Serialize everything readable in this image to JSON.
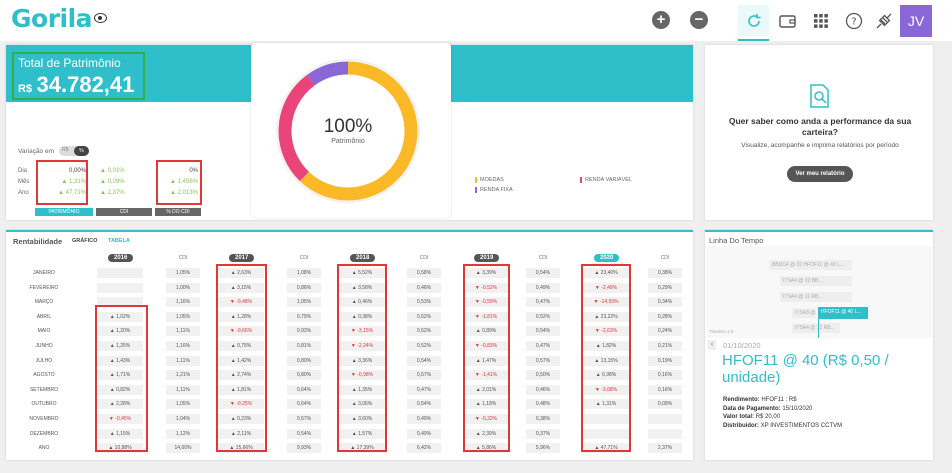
{
  "app": {
    "logo": "Gorila",
    "user_initials": "JV"
  },
  "icons": [
    "eye-icon",
    "plus-icon",
    "minus-icon",
    "refresh-icon",
    "wallet-icon",
    "grid-icon",
    "help-icon",
    "plug-icon"
  ],
  "patrimonio": {
    "title": "Total de Patrimônio",
    "currency": "R$",
    "value": "34.782,41",
    "variacao_label": "Variação em",
    "toggle_a": "R$",
    "toggle_b": "%",
    "row_labels": [
      "Dia",
      "Mês",
      "Ano"
    ],
    "col1": [
      "0,00%",
      "▲ 1,31%",
      "▲ 47,71%"
    ],
    "col2": [
      "▲ 0,01%",
      "▲ 0,09%",
      "▲ 2,37%"
    ],
    "col3": [
      "0%",
      "▲ 1,456%",
      "▲ 2,013%"
    ],
    "col_labels": [
      "PATRIMÔNIO",
      "CDI",
      "% DO CDI"
    ]
  },
  "donut": {
    "pct": "100%",
    "label": "Patrimônio"
  },
  "legend": [
    "MOEDAS",
    "RENDA VARIÁVEL",
    "RENDA FIXA"
  ],
  "colors": {
    "accent": "#2fbfca",
    "moedas": "#fbb827",
    "renda_variavel": "#e9457a",
    "renda_fixa": "#8a67d6"
  },
  "promo": {
    "title": "Quer saber como anda a performance da sua carteira?",
    "text": "Visualize, acompanhe e imprima relatórios por período",
    "button": "Ver meu relatório"
  },
  "rent": {
    "title": "Rentabilidade",
    "tab1": "GRÁFICO",
    "tab2": "TABELA",
    "years": [
      "2016",
      "2017",
      "2018",
      "2019",
      "2020"
    ],
    "cdi": "CDI",
    "months": [
      "JANEIRO",
      "FEVEREIRO",
      "MARÇO",
      "ABRIL",
      "MAIO",
      "JUNHO",
      "JULHO",
      "AGOSTO",
      "SETEMBRO",
      "OUTUBRO",
      "NOVEMBRO",
      "DEZEMBRO",
      "ANO"
    ],
    "c2016": [
      "",
      "",
      "",
      "▲ 1,02%",
      "▲ 1,20%",
      "▲ 1,25%",
      "▲ 1,43%",
      "▲ 1,71%",
      "▲ 0,82%",
      "▲ 2,28%",
      "▼ -0,45%",
      "▲ 1,15%",
      "▲ 10,88%"
    ],
    "cdi2016": [
      "1,05%",
      "1,00%",
      "1,16%",
      "1,05%",
      "1,11%",
      "1,16%",
      "1,11%",
      "1,21%",
      "1,11%",
      "1,05%",
      "1,04%",
      "1,12%",
      "14,00%"
    ],
    "c2017": [
      "▲ 2,63%",
      "▲ 3,15%",
      "▼ -0,48%",
      "▲ 1,28%",
      "▼ -0,66%",
      "▲ 0,75%",
      "▲ 1,42%",
      "▲ 2,74%",
      "▲ 1,81%",
      "▼ -0,25%",
      "▲ 0,23%",
      "▲ 2,11%",
      "▲ 15,66%"
    ],
    "cdi2017": [
      "1,08%",
      "0,86%",
      "1,05%",
      "0,79%",
      "0,93%",
      "0,81%",
      "0,80%",
      "0,80%",
      "0,64%",
      "0,64%",
      "0,57%",
      "0,54%",
      "9,93%"
    ],
    "c2018": [
      "▲ 5,52%",
      "▲ 3,58%",
      "▲ 0,46%",
      "▲ 0,38%",
      "▼ -3,15%",
      "▼ -2,24%",
      "▲ 3,36%",
      "▼ -0,98%",
      "▲ 1,35%",
      "▲ 3,06%",
      "▲ 3,60%",
      "▲ 1,57%",
      "▲ 17,39%"
    ],
    "cdi2018": [
      "0,58%",
      "0,46%",
      "0,53%",
      "0,52%",
      "0,52%",
      "0,52%",
      "0,54%",
      "0,57%",
      "0,47%",
      "0,54%",
      "0,49%",
      "0,49%",
      "6,42%"
    ],
    "c2019": [
      "▲ 3,39%",
      "▼ -0,52%",
      "▼ -0,59%",
      "▼ -1,81%",
      "▲ 0,89%",
      "▼ -0,83%",
      "▲ 1,47%",
      "▼ -1,41%",
      "▲ 2,01%",
      "▲ 1,18%",
      "▼ -0,32%",
      "▲ 2,39%",
      "▲ 5,86%"
    ],
    "cdi2019": [
      "0,54%",
      "0,49%",
      "0,47%",
      "0,52%",
      "0,54%",
      "0,47%",
      "0,57%",
      "0,50%",
      "0,46%",
      "0,48%",
      "0,38%",
      "0,37%",
      "5,96%"
    ],
    "c2020": [
      "▲ 23,40%",
      "▼ -2,49%",
      "▼ -14,93%",
      "▲ 23,22%",
      "▼ -2,63%",
      "▲ 1,82%",
      "▲ 13,15%",
      "▲ 6,98%",
      "▼ -3,68%",
      "▲ 1,31%",
      "",
      "",
      "▲ 47,71%"
    ],
    "cdi2020": [
      "0,38%",
      "0,29%",
      "0,34%",
      "0,28%",
      "0,24%",
      "0,21%",
      "0,19%",
      "0,16%",
      "0,16%",
      "0,09%",
      "",
      "",
      "2,37%"
    ]
  },
  "timeline": {
    "title": "Linha Do Tempo",
    "bars": [
      "BBDC4 @ 32 HFOF11 @ 40 L...",
      "ITSA4 @ 32 BB...",
      "ITSA4 @ 11 RB...",
      "ITSA3 @",
      "HFOF11 @ 40 L...",
      "ITSA4 @ 12 RB..."
    ],
    "marker": "Timeline 2.0",
    "date": "01/10/2020",
    "headline": "HFOF11 @ 40 (R$ 0,50 / unidade)",
    "details": [
      [
        "Rendimento:",
        "HFOF11 : R$"
      ],
      [
        "Data de Pagamento:",
        "15/10/2020"
      ],
      [
        "Valor total:",
        "R$ 20,00"
      ],
      [
        "Distribuidor:",
        "XP INVESTIMENTOS CCTVM"
      ]
    ]
  }
}
